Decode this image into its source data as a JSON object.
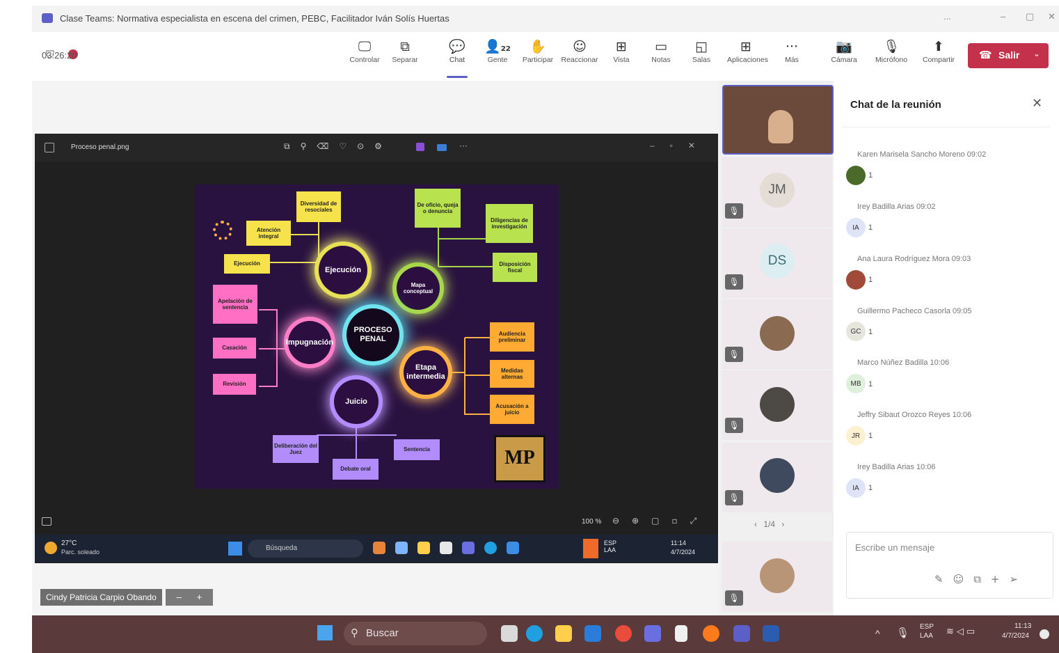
{
  "window": {
    "title": "Clase Teams: Normativa especialista en escena del crimen, PEBC, Facilitador Iván Solís Huertas",
    "controls": [
      "...",
      "–",
      "▢",
      "✕"
    ]
  },
  "meeting": {
    "timer": "03:26:20",
    "toolbar": [
      {
        "label": "Controlar",
        "icon": "control-icon"
      },
      {
        "label": "Separar",
        "icon": "pop-out-icon"
      },
      {
        "label": "Chat",
        "icon": "chat-icon",
        "active": true
      },
      {
        "label": "Gente",
        "icon": "people-icon",
        "badge": "22"
      },
      {
        "label": "Participar",
        "icon": "raise-hand-icon"
      },
      {
        "label": "Reaccionar",
        "icon": "react-icon"
      },
      {
        "label": "Vista",
        "icon": "view-icon"
      },
      {
        "label": "Notas",
        "icon": "notes-icon"
      },
      {
        "label": "Salas",
        "icon": "rooms-icon"
      },
      {
        "label": "Aplicaciones",
        "icon": "apps-icon"
      },
      {
        "label": "Más",
        "icon": "more-icon"
      },
      {
        "label": "Cámara",
        "icon": "camera-off-icon"
      },
      {
        "label": "Micrófono",
        "icon": "mic-off-icon"
      },
      {
        "label": "Compartir",
        "icon": "share-icon"
      }
    ],
    "leave_label": "Salir"
  },
  "shared": {
    "viewer_title": "Proceso penal.png",
    "zoom": "100 %",
    "mindmap": {
      "center": "PROCESO PENAL",
      "circles": [
        "Ejecución",
        "Mapa conceptual",
        "Impugnación",
        "Etapa intermedia",
        "Juicio"
      ],
      "yellow": [
        "Ejecución",
        "Atención integral",
        "Diversidad de resociales"
      ],
      "green": [
        "De oficio, queja o denuncia",
        "Diligencias de investigación",
        "Disposición fiscal"
      ],
      "pink": [
        "Apelación de sentencia",
        "Casación",
        "Revisión"
      ],
      "orange": [
        "Audiencia preliminar",
        "Medidas alternas",
        "Acusación a juicio"
      ],
      "purple": [
        "Deliberación del Juez",
        "Sentencia",
        "Debate oral"
      ],
      "logo": "MP"
    },
    "inner_taskbar": {
      "weather": "27°C",
      "weather_desc": "Parc. soleado",
      "search": "Búsqueda",
      "lang": "ESP LAA",
      "time": "11:14",
      "date": "4/7/2024"
    }
  },
  "presenter_tag": "Cindy Patricia Carpio Obando",
  "zoom_controls": [
    "–",
    "+"
  ],
  "participants": {
    "tiles": [
      {
        "initials": "JM",
        "bg": "#e8e2dc",
        "fg": "#5a5a5a"
      },
      {
        "initials": "DS",
        "bg": "#dceef1",
        "fg": "#3d6d77"
      }
    ],
    "pager": "1/4"
  },
  "chat": {
    "title": "Chat de la reunión",
    "messages": [
      {
        "name": "Karen Marisela Sancho Moreno  09:02",
        "avatar": "",
        "count": "1"
      },
      {
        "name": "Irey Badilla Arias  09:02",
        "avatar": "IA",
        "count": "1"
      },
      {
        "name": "Ana Laura Rodríguez Mora  09:03",
        "avatar": "",
        "count": "1"
      },
      {
        "name": "Guillermo Pacheco Casorla  09:05",
        "avatar": "GC",
        "count": "1"
      },
      {
        "name": "Marco Núñez Badilla  10:06",
        "avatar": "MB",
        "count": "1"
      },
      {
        "name": "Jeffry Sibaut Orozco Reyes  10:06",
        "avatar": "JR",
        "count": "1"
      },
      {
        "name": "Irey Badilla Arias  10:06",
        "avatar": "IA",
        "count": "1"
      }
    ],
    "compose_placeholder": "Escribe un mensaje"
  },
  "taskbar": {
    "search": "Buscar",
    "lang": "ESP LAA",
    "time": "11:13",
    "date": "4/7/2024"
  }
}
